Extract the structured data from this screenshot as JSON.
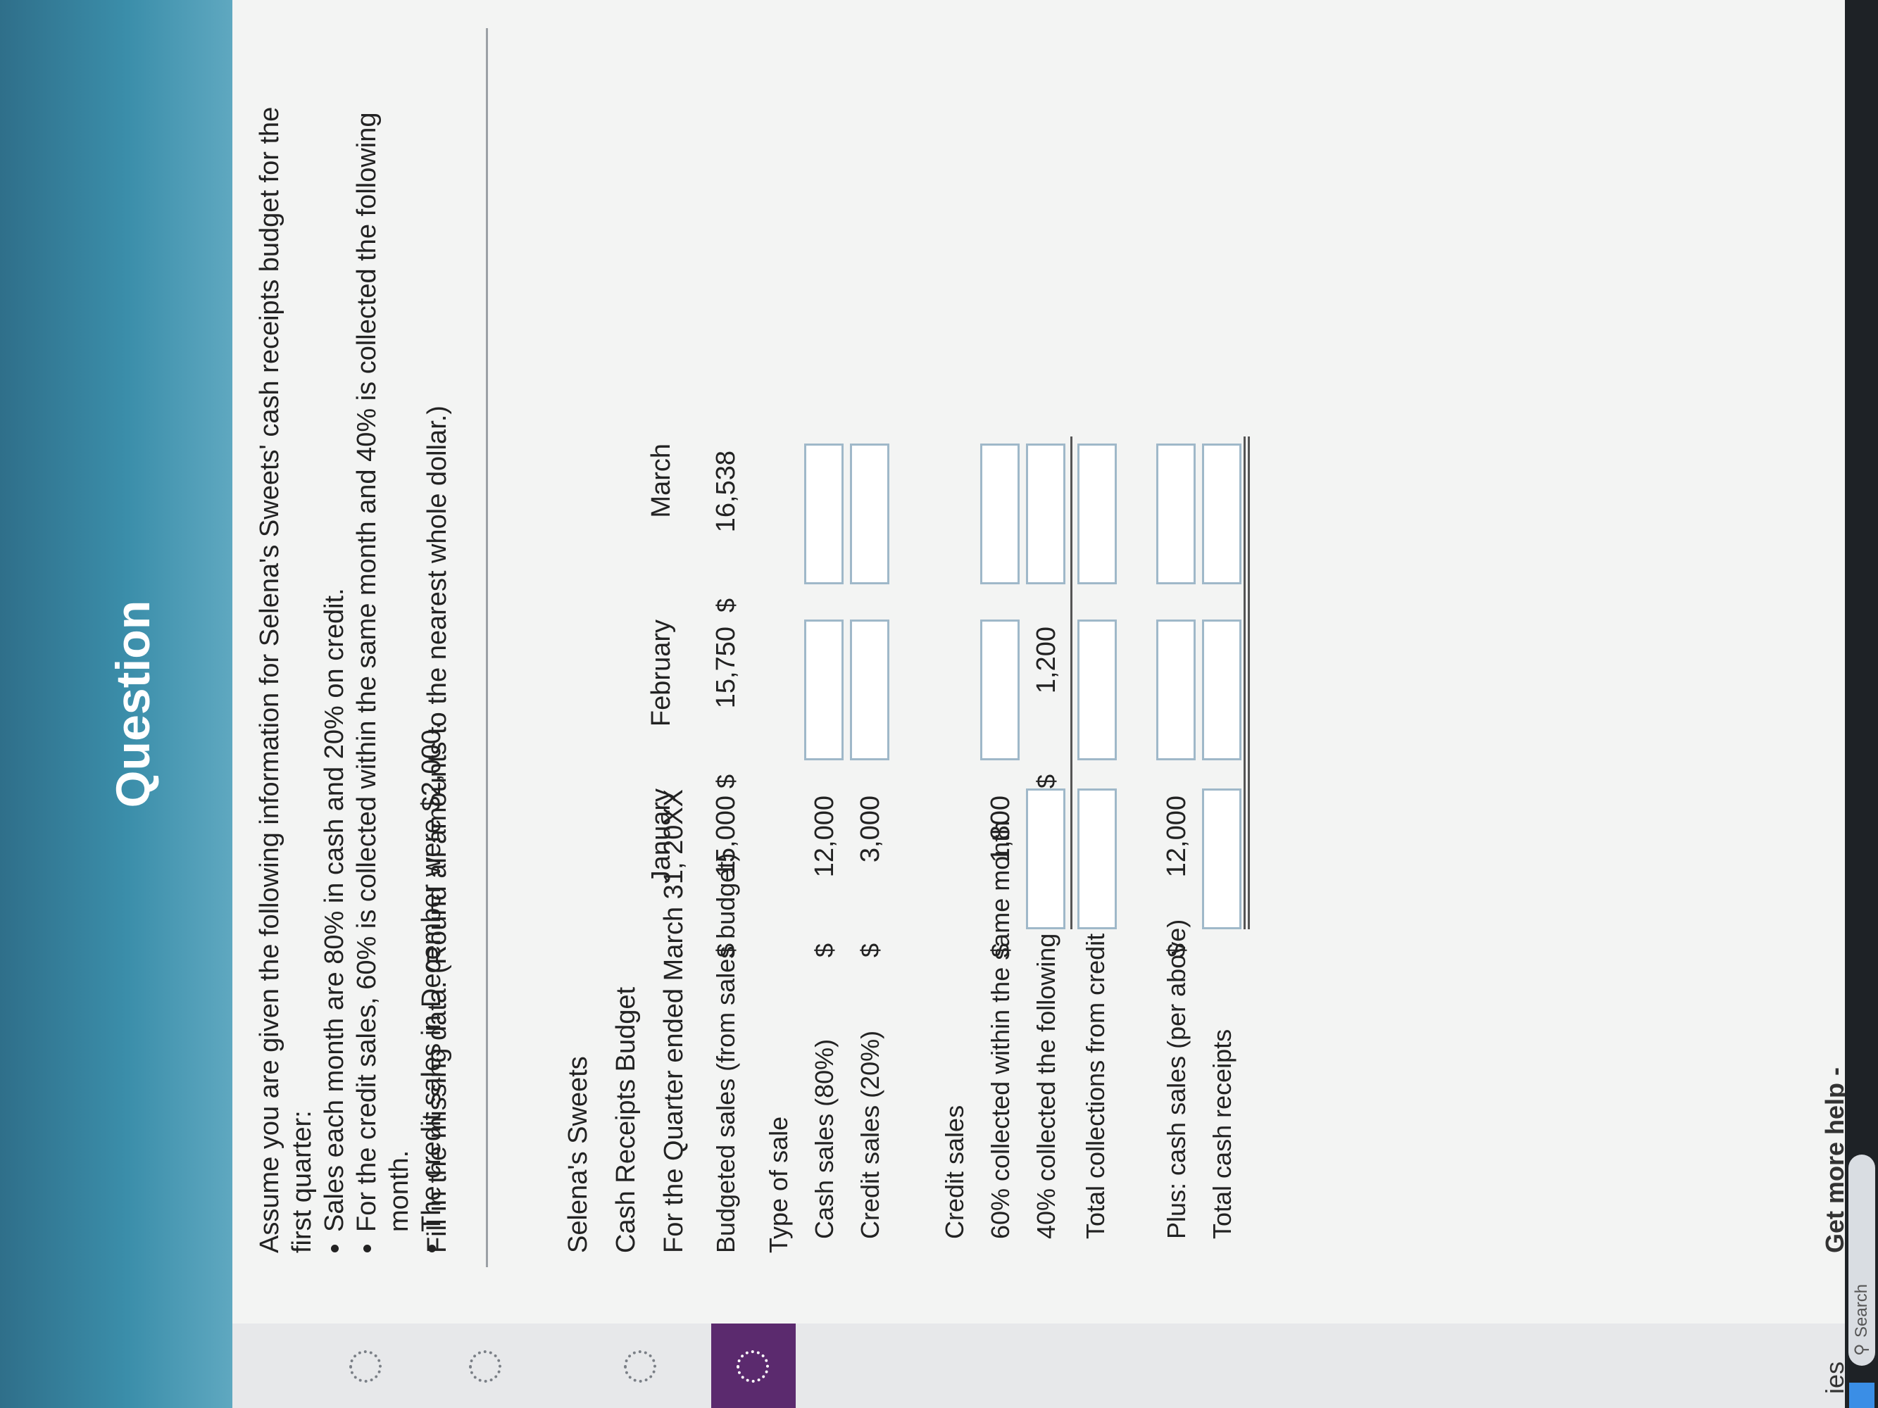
{
  "header": {
    "title": "Question"
  },
  "sidebar": {
    "partial_label": "ies"
  },
  "problem": {
    "intro": "Assume you are given the following information for Selena's Sweets' cash receipts budget for the first quarter:",
    "bullets": [
      "Sales each month are 80% in cash and 20% on credit.",
      "For the credit sales, 60% is collected within the same month and 40% is collected the following month.",
      "The credit sales in December were $2,000."
    ],
    "instruction": "Fill in the missing data. (Round all amounts to the nearest whole dollar.)"
  },
  "budget": {
    "company": "Selena's Sweets",
    "title": "Cash Receipts Budget",
    "period": "For the Quarter ended March 31, 20XX",
    "columns": [
      "January",
      "February",
      "March"
    ],
    "currency": "$",
    "rows": {
      "budgeted_sales": {
        "label": "Budgeted sales (from sales budget)",
        "values": [
          "15,000",
          "15,750",
          "16,538"
        ]
      },
      "type_of_sale": {
        "label": "Type of sale"
      },
      "cash_sales": {
        "label": "Cash sales (80%)",
        "values": [
          "12,000",
          "",
          ""
        ]
      },
      "credit_sales": {
        "label": "Credit sales (20%)",
        "values": [
          "3,000",
          "",
          ""
        ]
      },
      "credit_heading": {
        "label": "Credit sales"
      },
      "collected_same_month": {
        "label": "60% collected within the same month",
        "values": [
          "1,800",
          "",
          ""
        ]
      },
      "collected_following_month": {
        "label": "40% collected the following month",
        "values": [
          "",
          "1,200",
          ""
        ]
      },
      "total_collections": {
        "label": "Total collections from credit sales",
        "values": [
          "",
          "",
          ""
        ]
      },
      "plus_cash_sales": {
        "label": "Plus: cash sales (per above)",
        "values": [
          "12,000",
          "",
          ""
        ]
      },
      "total_cash_receipts": {
        "label": "Total cash receipts",
        "values": [
          "",
          "",
          ""
        ]
      }
    }
  },
  "footer": {
    "help_label": "Get more help -"
  },
  "taskbar": {
    "search_placeholder": "Search"
  },
  "colors": {
    "header": "#3b8eaa",
    "active_rail": "#5b2a6e",
    "input_border": "#9fb8c9"
  }
}
